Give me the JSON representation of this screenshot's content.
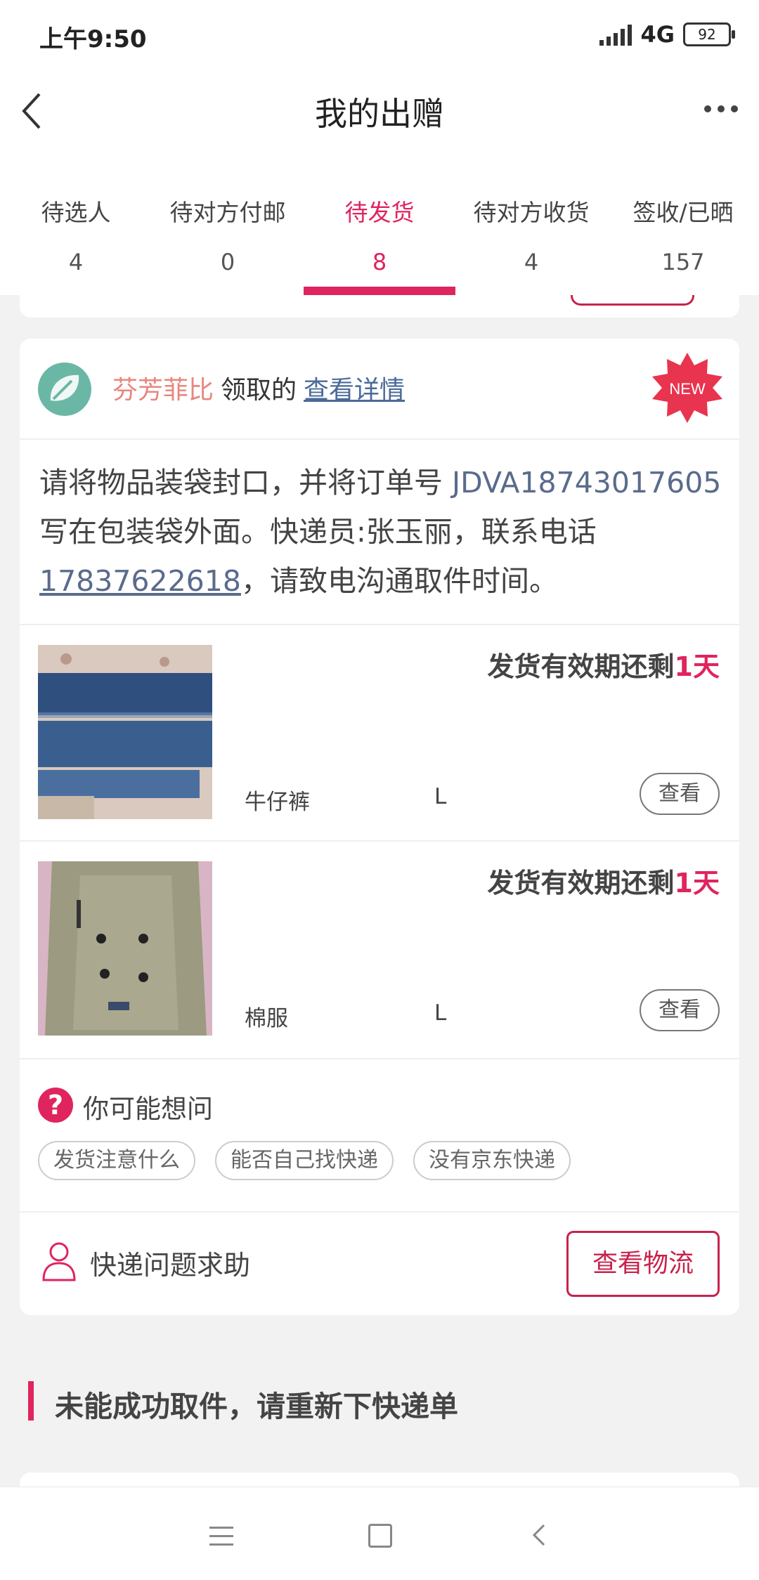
{
  "status_bar": {
    "time": "上午9:50",
    "network": "4G",
    "battery": "92"
  },
  "header": {
    "title": "我的出赠"
  },
  "tabs": [
    {
      "label": "待选人",
      "count": "4"
    },
    {
      "label": "待对方付邮",
      "count": "0"
    },
    {
      "label": "待发货",
      "count": "8",
      "active": true
    },
    {
      "label": "待对方收货",
      "count": "4"
    },
    {
      "label": "签收/已晒",
      "count": "157"
    }
  ],
  "card": {
    "owner_name": "芬芳菲比",
    "owner_verb": "领取的",
    "detail_link": "查看详情",
    "badge": "NEW",
    "instructions": {
      "part1": "请将物品装袋封口，并将订单号 ",
      "order_no": "JDVA18743017605",
      "part2": " 写在包装袋外面。快递员:张玉丽，联系电话",
      "phone": "17837622618",
      "part3": "，请致电沟通取件时间。"
    },
    "items": [
      {
        "deadline_prefix": "发货有效期还剩",
        "deadline_days": "1天",
        "name": "牛仔裤",
        "size": "L",
        "view_label": "查看"
      },
      {
        "deadline_prefix": "发货有效期还剩",
        "deadline_days": "1天",
        "name": "棉服",
        "size": "L",
        "view_label": "查看"
      }
    ],
    "faq": {
      "title": "你可能想问",
      "chips": [
        "发货注意什么",
        "能否自己找快递",
        "没有京东快递"
      ]
    },
    "help": {
      "text": "快递问题求助",
      "button": "查看物流"
    }
  },
  "section": {
    "title": "未能成功取件，请重新下快递单"
  },
  "colors": {
    "accent": "#e0245e",
    "link": "#4a6a9a",
    "owner_name": "#e8867f",
    "badge": "#e8344e"
  }
}
